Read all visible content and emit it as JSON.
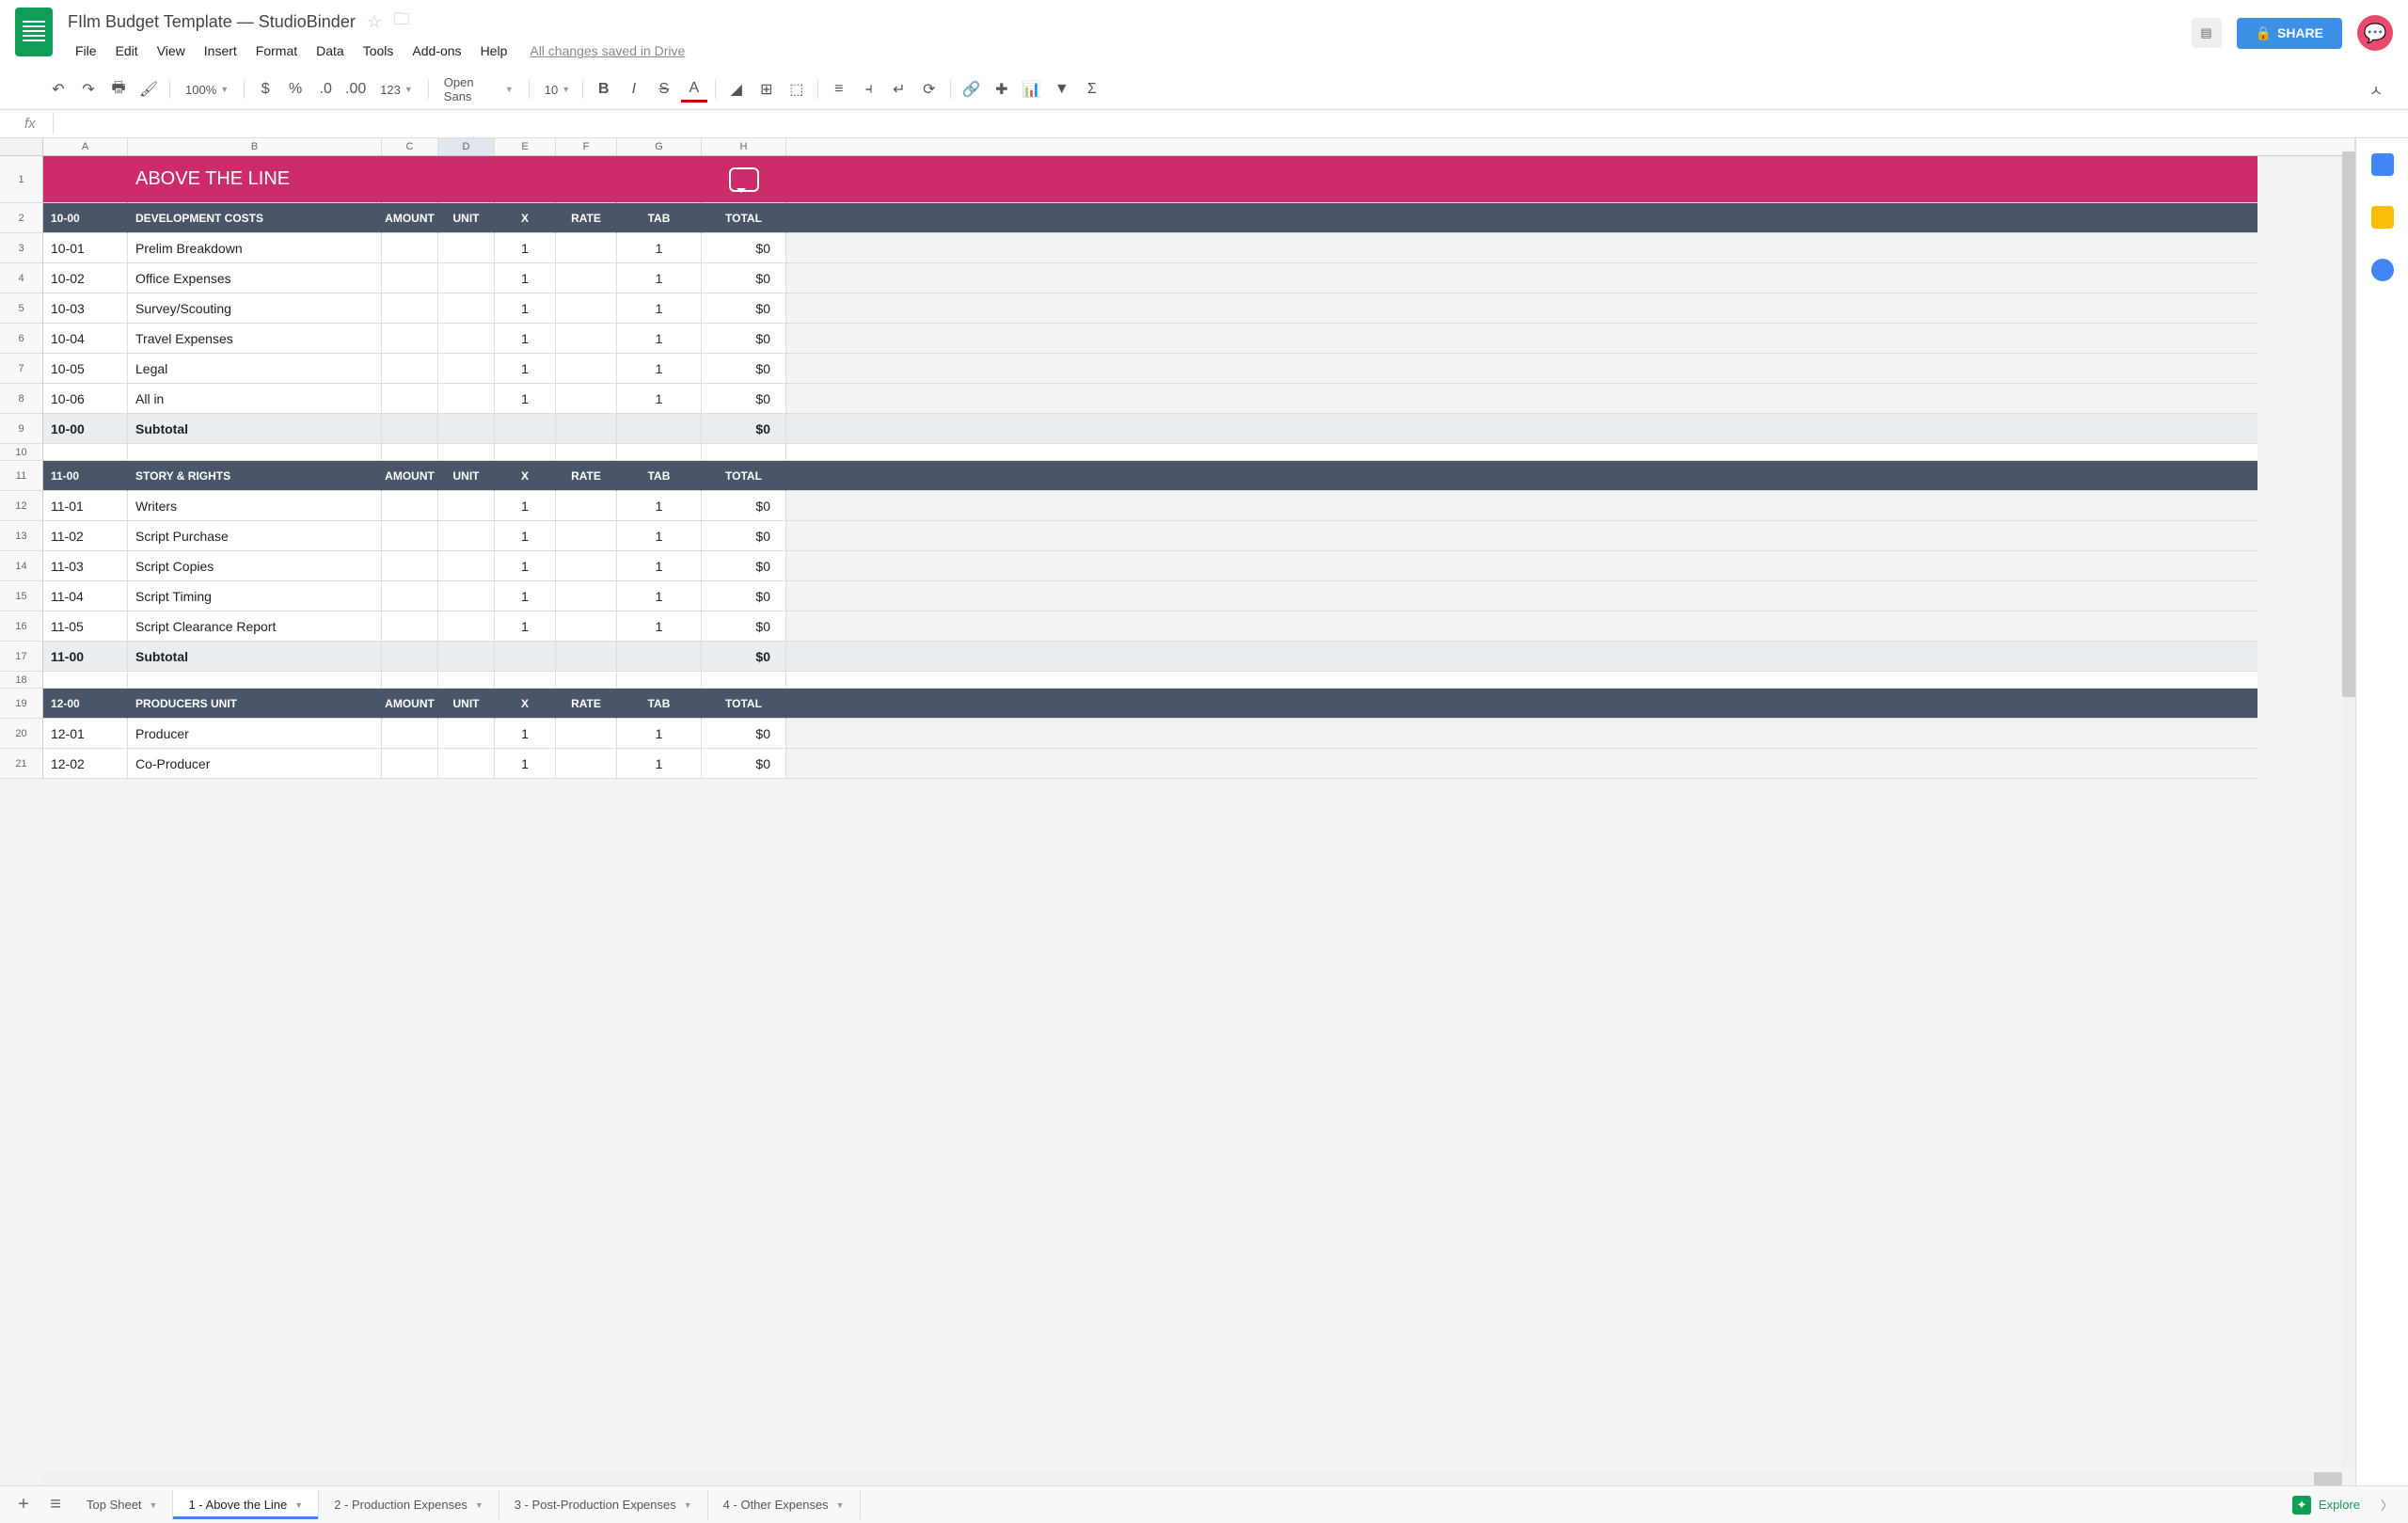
{
  "doc": {
    "title": "FIlm Budget Template — StudioBinder"
  },
  "menus": [
    "File",
    "Edit",
    "View",
    "Insert",
    "Format",
    "Data",
    "Tools",
    "Add-ons",
    "Help"
  ],
  "drive_status": "All changes saved in Drive",
  "share": "SHARE",
  "toolbar": {
    "zoom": "100%",
    "font": "Open Sans",
    "size": "10",
    "fmt123": "123"
  },
  "columns": [
    "A",
    "B",
    "C",
    "D",
    "E",
    "F",
    "G",
    "H"
  ],
  "selected_col": "D",
  "title_row": {
    "label": "ABOVE THE LINE"
  },
  "section_headers": [
    "AMOUNT",
    "UNIT",
    "X",
    "RATE",
    "TAB",
    "TOTAL"
  ],
  "sections": [
    {
      "code": "10-00",
      "name": "DEVELOPMENT COSTS",
      "rows": [
        {
          "n": "3",
          "code": "10-01",
          "desc": "Prelim Breakdown",
          "x": "1",
          "tab": "1",
          "total": "$0"
        },
        {
          "n": "4",
          "code": "10-02",
          "desc": "Office Expenses",
          "x": "1",
          "tab": "1",
          "total": "$0"
        },
        {
          "n": "5",
          "code": "10-03",
          "desc": "Survey/Scouting",
          "x": "1",
          "tab": "1",
          "total": "$0"
        },
        {
          "n": "6",
          "code": "10-04",
          "desc": "Travel Expenses",
          "x": "1",
          "tab": "1",
          "total": "$0"
        },
        {
          "n": "7",
          "code": "10-05",
          "desc": "Legal",
          "x": "1",
          "tab": "1",
          "total": "$0"
        },
        {
          "n": "8",
          "code": "10-06",
          "desc": "All in",
          "x": "1",
          "tab": "1",
          "total": "$0"
        }
      ],
      "subtotal": {
        "n": "9",
        "code": "10-00",
        "label": "Subtotal",
        "total": "$0"
      },
      "header_n": "2",
      "blank_n": "10"
    },
    {
      "code": "11-00",
      "name": "STORY & RIGHTS",
      "rows": [
        {
          "n": "12",
          "code": "11-01",
          "desc": "Writers",
          "x": "1",
          "tab": "1",
          "total": "$0"
        },
        {
          "n": "13",
          "code": "11-02",
          "desc": "Script Purchase",
          "x": "1",
          "tab": "1",
          "total": "$0"
        },
        {
          "n": "14",
          "code": "11-03",
          "desc": "Script Copies",
          "x": "1",
          "tab": "1",
          "total": "$0"
        },
        {
          "n": "15",
          "code": "11-04",
          "desc": "Script Timing",
          "x": "1",
          "tab": "1",
          "total": "$0"
        },
        {
          "n": "16",
          "code": "11-05",
          "desc": "Script Clearance Report",
          "x": "1",
          "tab": "1",
          "total": "$0"
        }
      ],
      "subtotal": {
        "n": "17",
        "code": "11-00",
        "label": "Subtotal",
        "total": "$0"
      },
      "header_n": "11",
      "blank_n": "18"
    },
    {
      "code": "12-00",
      "name": "PRODUCERS UNIT",
      "rows": [
        {
          "n": "20",
          "code": "12-01",
          "desc": "Producer",
          "x": "1",
          "tab": "1",
          "total": "$0"
        },
        {
          "n": "21",
          "code": "12-02",
          "desc": "Co-Producer",
          "x": "1",
          "tab": "1",
          "total": "$0"
        }
      ],
      "header_n": "19"
    }
  ],
  "tabs": [
    {
      "label": "Top Sheet",
      "active": false
    },
    {
      "label": "1 - Above the Line",
      "active": true
    },
    {
      "label": "2 - Production Expenses",
      "active": false
    },
    {
      "label": "3 - Post-Production Expenses",
      "active": false
    },
    {
      "label": "4 - Other Expenses",
      "active": false
    }
  ],
  "explore": "Explore"
}
